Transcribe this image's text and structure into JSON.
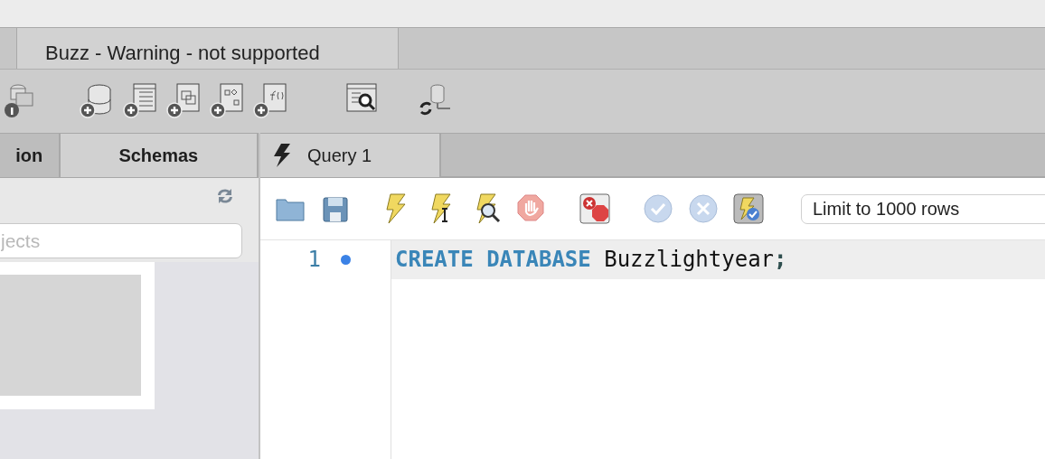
{
  "document_tabs": [
    {
      "label": "Buzz - Warning - not supported",
      "selected": true
    }
  ],
  "sidebar": {
    "tabs": [
      {
        "label": "ion",
        "selected": false
      },
      {
        "label": "Schemas",
        "selected": true
      }
    ],
    "search": {
      "placeholder": "jects"
    }
  },
  "editor": {
    "tabs": [
      {
        "label": "Query 1",
        "selected": true
      }
    ],
    "limit_select": {
      "value": "Limit to 1000 rows"
    },
    "lines": [
      {
        "number": "1",
        "marker": true,
        "tokens": [
          {
            "kind": "keyword",
            "text": "CREATE DATABASE"
          },
          {
            "kind": "plain",
            "text": " Buzzlightyear"
          },
          {
            "kind": "punct",
            "text": ";"
          }
        ]
      }
    ]
  }
}
